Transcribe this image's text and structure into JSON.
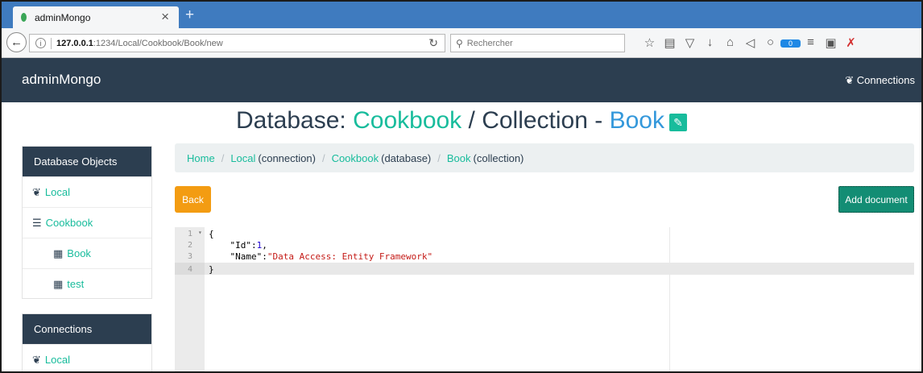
{
  "browser": {
    "tab_title": "adminMongo",
    "url_host": "127.0.0.1",
    "url_path": ":1234/Local/Cookbook/Book/new",
    "search_placeholder": "Rechercher",
    "notification_count": "0"
  },
  "app": {
    "brand": "adminMongo",
    "connections_link": "Connections"
  },
  "heading": {
    "database_label": "Database: ",
    "database_name": "Cookbook",
    "collection_label": " / Collection - ",
    "collection_name": "Book"
  },
  "sidebar": {
    "objects_title": "Database Objects",
    "connection_item": "Local",
    "database_item": "Cookbook",
    "collections": [
      "Book",
      "test"
    ],
    "connections_title": "Connections",
    "connections_items": [
      "Local"
    ]
  },
  "breadcrumb": {
    "home": "Home",
    "connection_name": "Local",
    "connection_suffix": "(connection)",
    "database_name": "Cookbook",
    "database_suffix": "(database)",
    "collection_name": "Book",
    "collection_suffix": "(collection)"
  },
  "buttons": {
    "back": "Back",
    "add_document": "Add document"
  },
  "editor": {
    "line_numbers": [
      "1",
      "2",
      "3",
      "4"
    ],
    "line1": "{",
    "line2_key": "    \"Id\":",
    "line2_value": "1",
    "line2_comma": ",",
    "line3_key": "    \"Name\":",
    "line3_value": "\"Data Access: Entity Framework\"",
    "line4": "}"
  }
}
